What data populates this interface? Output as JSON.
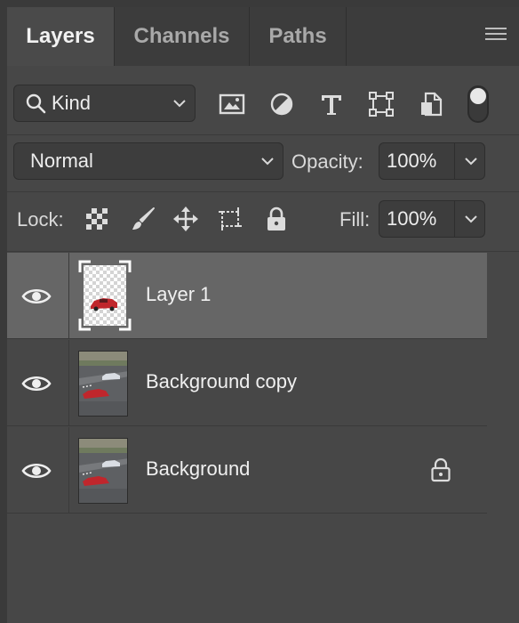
{
  "tabs": [
    {
      "label": "Layers",
      "active": true
    },
    {
      "label": "Channels",
      "active": false
    },
    {
      "label": "Paths",
      "active": false
    }
  ],
  "filter": {
    "kind_label": "Kind"
  },
  "blend": {
    "mode": "Normal",
    "opacity_label": "Opacity:",
    "opacity_value": "100%"
  },
  "lock": {
    "label": "Lock:",
    "fill_label": "Fill:",
    "fill_value": "100%"
  },
  "layers": [
    {
      "name": "Layer 1",
      "selected": true,
      "locked": false
    },
    {
      "name": "Background copy",
      "selected": false,
      "locked": false
    },
    {
      "name": "Background",
      "selected": false,
      "locked": true
    }
  ],
  "colors": {
    "selected_row": "#666666",
    "panel": "#474747",
    "tab_bar": "#3c3c3c",
    "car_red": "#c0262c"
  }
}
